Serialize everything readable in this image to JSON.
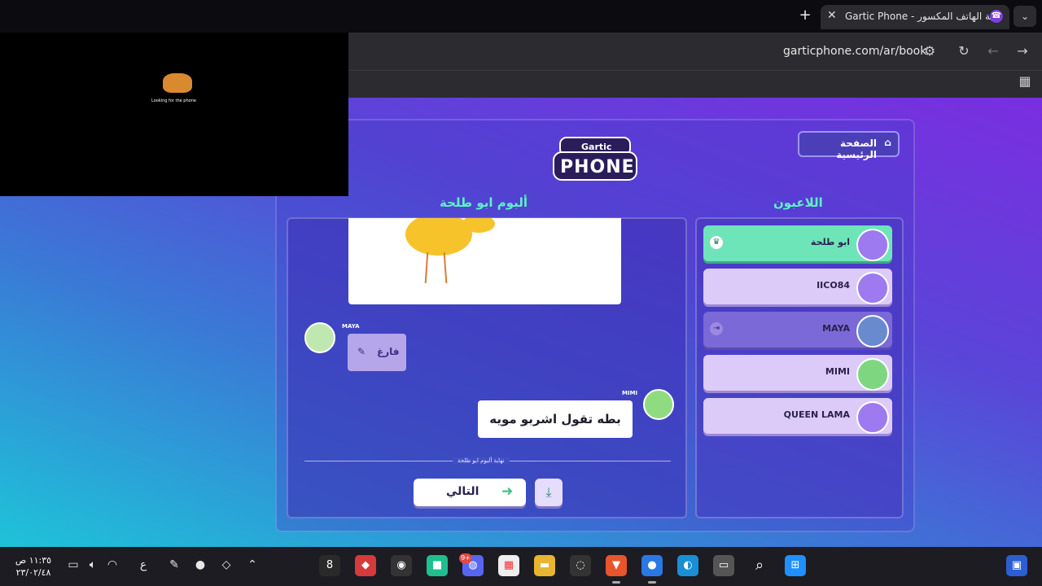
{
  "browser": {
    "tab_title": "Gartic Phone - لعبة الهاتف المكسور",
    "url": "garticphone.com/ar/book",
    "new_tab": "+",
    "close": "✕"
  },
  "pip": {
    "caption": "Looking for the phone"
  },
  "game": {
    "home_button": "الصفحة الرئيسية",
    "logo_top": "Gartic",
    "logo_bottom": "PHONE",
    "players_heading": "اللاعبون",
    "album_heading": "ألبوم ابو طلحة",
    "players": [
      {
        "name": "ابو طلحة",
        "state": "host"
      },
      {
        "name": "IICO84",
        "state": "normal"
      },
      {
        "name": "MAYA",
        "state": "away"
      },
      {
        "name": "MIMI",
        "state": "normal"
      },
      {
        "name": "QUEEN LAMA",
        "state": "normal"
      }
    ],
    "maya_label": "MAYA",
    "empty_text": "فارغ",
    "mimi_label": "MIMI",
    "guess_text": "بطه تقول اشربو مويه",
    "end_label": "نهاية ألبوم ابو طلحة",
    "next_button": "التالي"
  },
  "taskbar": {
    "time": "١١:٣٥ ص",
    "date": "٢٣/٠٢/٤٨",
    "lang": "ع",
    "notification_badge": "9+"
  },
  "colors": {
    "accent_green": "#5ef2c5",
    "page_gradient_top": "#7a2ee0",
    "page_gradient_bottom": "#1ec3d8"
  }
}
